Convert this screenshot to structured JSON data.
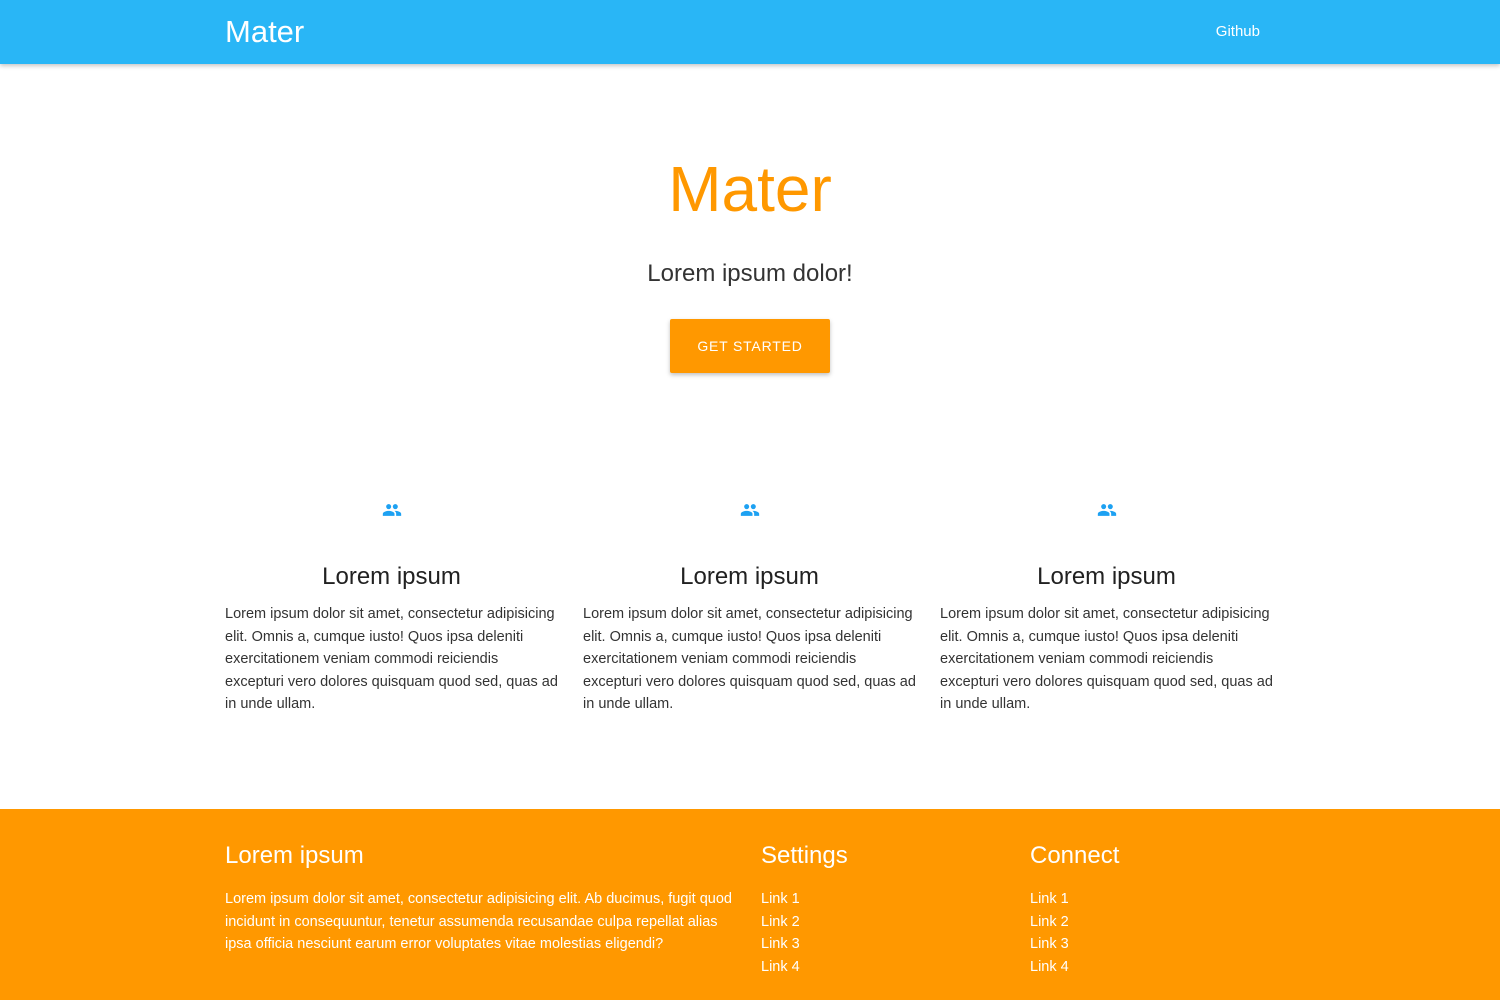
{
  "navbar": {
    "brand": "Mater",
    "links": [
      {
        "label": "Github"
      }
    ],
    "background": "#29b6f6"
  },
  "hero": {
    "title": "Mater",
    "subtitle": "Lorem ipsum dolor!",
    "cta_label": "GET STARTED",
    "accent": "#ff9800"
  },
  "features": [
    {
      "icon": "group-icon",
      "title": "Lorem ipsum",
      "text": "Lorem ipsum dolor sit amet, consectetur adipisicing elit. Omnis a, cumque iusto! Quos ipsa deleniti exercitationem veniam commodi reiciendis excepturi vero dolores quisquam quod sed, quas ad in unde ullam."
    },
    {
      "icon": "group-icon",
      "title": "Lorem ipsum",
      "text": "Lorem ipsum dolor sit amet, consectetur adipisicing elit. Omnis a, cumque iusto! Quos ipsa deleniti exercitationem veniam commodi reiciendis excepturi vero dolores quisquam quod sed, quas ad in unde ullam."
    },
    {
      "icon": "group-icon",
      "title": "Lorem ipsum",
      "text": "Lorem ipsum dolor sit amet, consectetur adipisicing elit. Omnis a, cumque iusto! Quos ipsa deleniti exercitationem veniam commodi reiciendis excepturi vero dolores quisquam quod sed, quas ad in unde ullam."
    }
  ],
  "footer": {
    "about": {
      "heading": "Lorem ipsum",
      "text": "Lorem ipsum dolor sit amet, consectetur adipisicing elit. Ab ducimus, fugit quod incidunt in consequuntur, tenetur assumenda recusandae culpa repellat alias ipsa officia nesciunt earum error voluptates vitae molestias eligendi?"
    },
    "settings": {
      "heading": "Settings",
      "links": [
        "Link 1",
        "Link 2",
        "Link 3",
        "Link 4"
      ]
    },
    "connect": {
      "heading": "Connect",
      "links": [
        "Link 1",
        "Link 2",
        "Link 3",
        "Link 4"
      ]
    },
    "background": "#ff9800"
  },
  "colors": {
    "icon": "#1da1f2"
  }
}
